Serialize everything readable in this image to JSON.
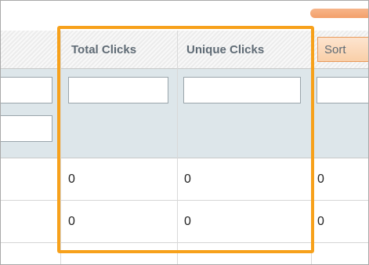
{
  "columns": {
    "total_clicks": "Total Clicks",
    "unique_clicks": "Unique Clicks"
  },
  "sort_button": "Sort",
  "rows": [
    {
      "total_clicks": "0",
      "unique_clicks": "0",
      "next": "0"
    },
    {
      "total_clicks": "0",
      "unique_clicks": "0",
      "next": "0"
    }
  ],
  "colors": {
    "highlight": "#f7a11b",
    "filter_bg": "#dde6ea",
    "header_text": "#5f6b75",
    "sort_border": "#e89a5c"
  }
}
